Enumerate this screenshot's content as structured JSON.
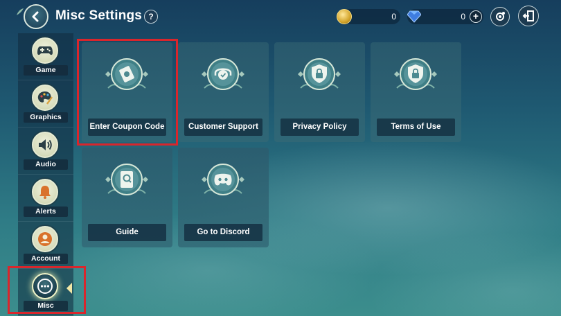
{
  "header": {
    "title": "Misc Settings",
    "help_label": "?",
    "coins": "0",
    "gems": "0",
    "plus_label": "+"
  },
  "sidebar": {
    "items": [
      {
        "label": "Game",
        "icon": "gamepad-icon"
      },
      {
        "label": "Graphics",
        "icon": "palette-icon"
      },
      {
        "label": "Audio",
        "icon": "speaker-icon"
      },
      {
        "label": "Alerts",
        "icon": "bell-icon"
      },
      {
        "label": "Account",
        "icon": "user-icon"
      },
      {
        "label": "Misc",
        "icon": "more-dots-icon",
        "active": true
      }
    ]
  },
  "cards": [
    {
      "label": "Enter Coupon Code",
      "icon": "coupon-ticket-icon",
      "highlighted": true
    },
    {
      "label": "Customer Support",
      "icon": "headset-chat-icon"
    },
    {
      "label": "Privacy Policy",
      "icon": "lock-shield-icon"
    },
    {
      "label": "Terms of Use",
      "icon": "lock-shield-icon"
    },
    {
      "label": "Guide",
      "icon": "guide-book-icon"
    },
    {
      "label": "Go to Discord",
      "icon": "discord-icon"
    }
  ],
  "colors": {
    "highlight": "#d9262c",
    "accent": "#f1e7a6"
  }
}
